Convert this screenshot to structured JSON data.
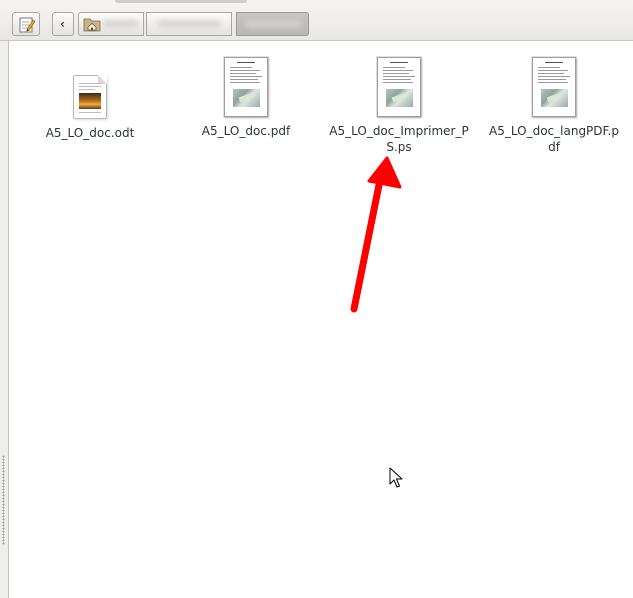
{
  "toolbar": {
    "edit_tooltip": "",
    "back_label": "‹"
  },
  "files": [
    {
      "name": "A5_LO_doc.odt",
      "type": "odt"
    },
    {
      "name": "A5_LO_doc.pdf",
      "type": "pdf"
    },
    {
      "name": "A5_LO_doc_Imprimer_PS.ps",
      "type": "ps"
    },
    {
      "name": "A5_LO_doc_langPDF.pdf",
      "type": "pdf"
    }
  ],
  "colors": {
    "annotation_arrow": "#ff0000",
    "window_bg": "#f2f1f0",
    "pane_bg": "#ffffff"
  },
  "icons": {
    "edit": "pencil-icon",
    "back": "chevron-left-icon",
    "home": "home-folder-icon",
    "cursor": "mouse-pointer-icon"
  }
}
